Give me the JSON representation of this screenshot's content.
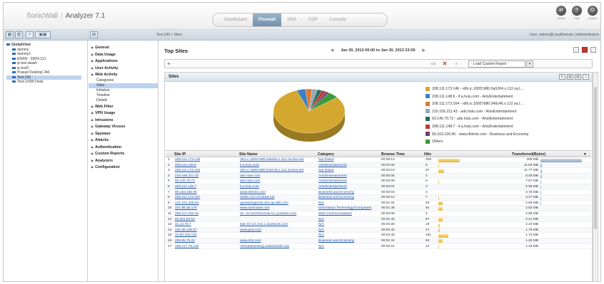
{
  "header": {
    "brand": "SonicWall",
    "product": "Analyzer 7.1",
    "tabs": [
      "Dashboard",
      "Firewall",
      "SRA",
      "CDP",
      "Console"
    ],
    "active_tab": "Firewall",
    "icons": [
      {
        "icon": "switch-icon",
        "label": "Switch"
      },
      {
        "icon": "help-icon",
        "label": "Help"
      },
      {
        "icon": "logout-icon",
        "label": "Logout"
      }
    ]
  },
  "toolbar": {
    "path": "Test 240 > Sites",
    "user": "User: admin@LocalDomain | Administrators"
  },
  "tree": {
    "root": "GlobalView",
    "items": [
      "dummy",
      "dummy1",
      "E5000 - 6D04.121",
      "ip test akash",
      "ip test2",
      "Prasad Desktop 240",
      "Test 240",
      "Test-210W Desk"
    ],
    "selected": "Test 240"
  },
  "nav": {
    "items_before": [
      "General",
      "Data Usage",
      "Applications",
      "User Activity",
      "Web Activity"
    ],
    "web_activity_subs": [
      "Categories",
      "Sites",
      "Initiators",
      "Timeline",
      "Details"
    ],
    "selected_sub": "Sites",
    "items_after": [
      "Web Filter",
      "VPN Usage",
      "Intrusions",
      "Gateway Viruses",
      "Spyware",
      "Attacks",
      "Authentication",
      "Custom Reports",
      "Analyzers",
      "Configuration"
    ]
  },
  "main": {
    "title": "Top Sites",
    "date_range": "Jan 30, 2013 00:00 to Jan 30, 2013 23:59",
    "filter_add": "+",
    "report_select": "- Load Custom Report -",
    "panel_title": "Sites"
  },
  "chart_data": {
    "type": "pie",
    "series_colors": [
      "#d4a82e",
      "#3b7fc4",
      "#e07a2e",
      "#9aa6b2",
      "#1f6e5e",
      "#c0392b",
      "#7a3b7a",
      "#3a9a3a"
    ],
    "legend": [
      "208.111.173.146 - rdfx.ic.18057d80.0a5264.x.112.na.l....",
      "208.111.148.6 - ll.a.hulu.com - Arts/Entertainment",
      "208.111.173.164 - rdfx.ic.18057d80.040c46.x.112.na.l....",
      "216.156.211.43 - ads.hulu.com - Arts/Entertainment",
      "63.146.70.72 - ads.hulu.com - Arts/Entertainment",
      "208.111.148.7 - ll.a.hulu.com - Arts/Entertainment",
      "69.163.165.96 - www.dhtmlx.com - Business and Economy",
      "Others"
    ],
    "values": [
      80,
      4,
      3,
      2.5,
      2,
      2,
      1.5,
      5
    ]
  },
  "table": {
    "headers": [
      "Site IP",
      "Site Name",
      "Category",
      "Browse Time",
      "Hits",
      "Transferred(Bytes)"
    ],
    "max_hits": 329,
    "max_transferred": 309,
    "rows": [
      {
        "n": "1",
        "ip": "208.111.173.146",
        "name": "rdfx.ic.18057d80.0a5264.x.112.na.llnw.net",
        "cat": "Not Rated",
        "time": "00:08:13",
        "hits": "329",
        "hits_v": 329,
        "bytes": "309 MB",
        "bytes_v": 309
      },
      {
        "n": "2",
        "ip": "208.111.148.6",
        "name": "ll.a.hulu.com",
        "cat": "Arts/Entertainment",
        "time": "00:00:06",
        "hits": "6",
        "hits_v": 6,
        "bytes": "11.83 MB",
        "bytes_v": 11.83
      },
      {
        "n": "3",
        "ip": "208.111.173.164",
        "name": "rdfx.ic.18057d80.040c46.x.112.na.llnw.net",
        "cat": "Not Rated",
        "time": "00:02:10",
        "hits": "87",
        "hits_v": 87,
        "bytes": "11.77 MB",
        "bytes_v": 11.77
      },
      {
        "n": "4",
        "ip": "216.156.211.43",
        "name": "ads.hulu.com",
        "cat": "Arts/Entertainment",
        "time": "00:00:06",
        "hits": "4",
        "hits_v": 4,
        "bytes": "8.09 MB",
        "bytes_v": 8.09
      },
      {
        "n": "5",
        "ip": "63.146.70.72",
        "name": "ads.hulu.com",
        "cat": "Arts/Entertainment",
        "time": "00:00:09",
        "hits": "6",
        "hits_v": 6,
        "bytes": "7.67 MB",
        "bytes_v": 7.67
      },
      {
        "n": "6",
        "ip": "208.111.148.7",
        "name": "ll.a.hulu.com",
        "cat": "Arts/Entertainment",
        "time": "00:00:04",
        "hits": "3",
        "hits_v": 3,
        "bytes": "6.98 MB",
        "bytes_v": 6.98
      },
      {
        "n": "7",
        "ip": "69.163.165.96",
        "name": "www.dhtmlx.com",
        "cat": "Business and Economy",
        "time": "00:00:03",
        "hits": "2",
        "hits_v": 2,
        "bytes": "3.76 MB",
        "bytes_v": 3.76
      },
      {
        "n": "8",
        "ip": "208.111.173.187",
        "name": "netflix-112.vo.llnwd.net",
        "cat": "Business and Economy",
        "time": "00:00:10",
        "hits": "7",
        "hits_v": 7,
        "bytes": "3.27 MB",
        "bytes_v": 3.27
      },
      {
        "n": "9",
        "ip": "141.101.255.64",
        "name": "questsongs102-dns.ap.dell.com",
        "cat": "N/A",
        "time": "00:01:34",
        "hits": "63",
        "hits_v": 63,
        "bytes": "2.69 MB",
        "bytes_v": 2.69
      },
      {
        "n": "10",
        "ip": "107.89.36.170",
        "name": "www.sonicwall.com",
        "cat": "Information Technology/Computers",
        "time": "00:01:38",
        "hits": "64",
        "hits_v": 64,
        "bytes": "2.62 MB",
        "bytes_v": 2.62
      },
      {
        "n": "11",
        "ip": "208.117.232.16",
        "name": "r5---sn-tch7bxvnrvw-5.c.youtube.com",
        "cat": "Web Communications",
        "time": "00:00:06",
        "hits": "4",
        "hits_v": 4,
        "bytes": "2.58 MB",
        "bytes_v": 2.58
      },
      {
        "n": "12",
        "ip": "63.251.84.54",
        "name": "",
        "cat": "N/A",
        "time": "00:01:40",
        "hits": "67",
        "hits_v": 67,
        "bytes": "2.41 MB",
        "bytes_v": 2.41
      },
      {
        "n": "13",
        "ip": "31.13.75.7",
        "name": "star-31-13-cms.1.facebook.com",
        "cat": "N/A",
        "time": "00:00:28",
        "hits": "19",
        "hits_v": 19,
        "bytes": "2.24 MB",
        "bytes_v": 2.24
      },
      {
        "n": "14",
        "ip": "131.85.128.67",
        "name": "www.psw.com",
        "cat": "N/A",
        "time": "00:00:40",
        "hits": "27",
        "hits_v": 27,
        "bytes": "1.79 MB",
        "bytes_v": 1.79
      },
      {
        "n": "15",
        "ip": "10.50.163.120",
        "name": "",
        "cat": "N/A",
        "time": "00:03:49",
        "hits": "151",
        "hits_v": 151,
        "bytes": "1.73 MB",
        "bytes_v": 1.73
      },
      {
        "n": "16",
        "ip": "209.65.75.21",
        "name": "www.nhs.com",
        "cat": "Business and Economy",
        "time": "00:01:34",
        "hits": "63",
        "hits_v": 63,
        "bytes": "1.25 MB",
        "bytes_v": 1.25
      },
      {
        "n": "17",
        "ip": "198.217.75.125",
        "name": "noheadtweeting.autterhealth.org",
        "cat": "N/A",
        "time": "00:00:21",
        "hits": "14",
        "hits_v": 14,
        "bytes": "1.18 MB",
        "bytes_v": 1.18
      }
    ]
  }
}
